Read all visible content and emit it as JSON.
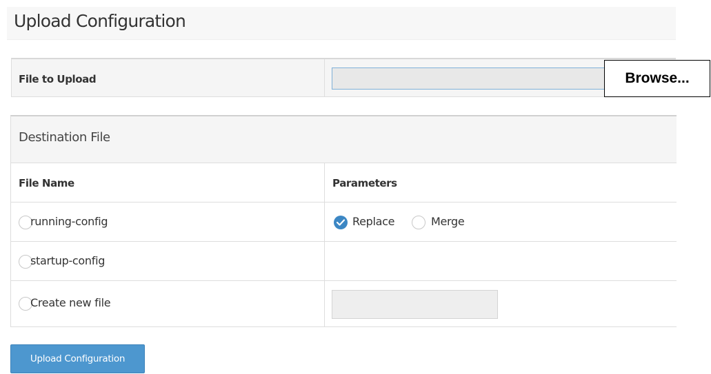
{
  "page": {
    "title": "Upload Configuration"
  },
  "upload": {
    "label": "File to Upload",
    "file_value": "",
    "browse_label": "Browse..."
  },
  "destination": {
    "title": "Destination File",
    "headers": {
      "file_name": "File Name",
      "parameters": "Parameters"
    },
    "rows": [
      {
        "file_name": "running-config",
        "selected": false,
        "parameters": [
          {
            "label": "Replace",
            "selected": true
          },
          {
            "label": "Merge",
            "selected": false
          }
        ]
      },
      {
        "file_name": "startup-config",
        "selected": false
      },
      {
        "file_name": "Create new file",
        "selected": false,
        "new_file_value": ""
      }
    ]
  },
  "submit": {
    "label": "Upload Configuration"
  },
  "colors": {
    "accent": "#3c87c4",
    "button": "#4d97cf"
  }
}
